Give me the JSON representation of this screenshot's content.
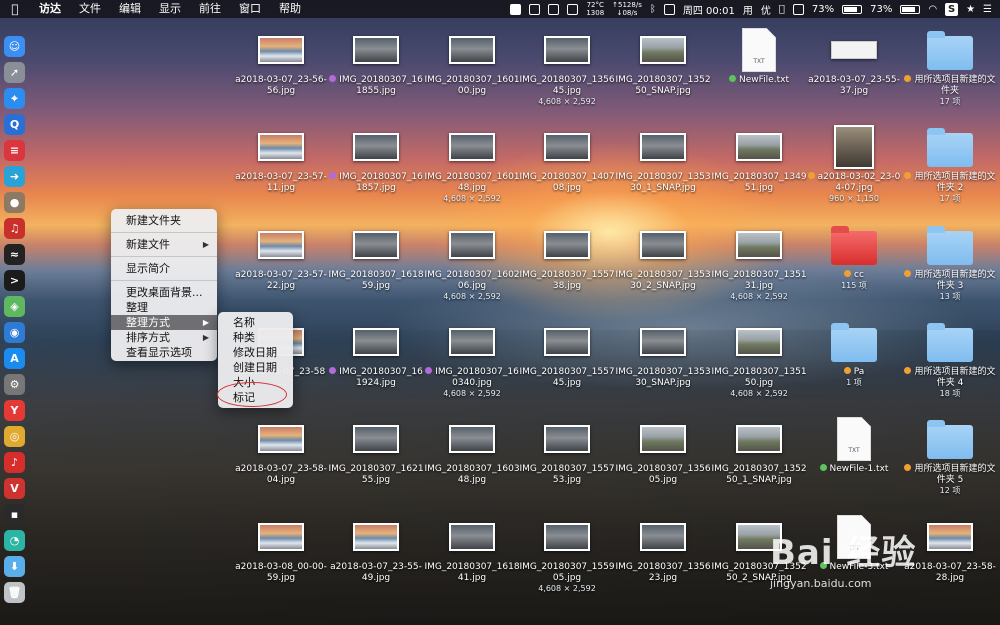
{
  "menubar": {
    "apple": "",
    "items": [
      "访达",
      "文件",
      "编辑",
      "显示",
      "前往",
      "窗口",
      "帮助"
    ],
    "status": {
      "temp": "72°C",
      "rpm": "1308",
      "net_up": "↑5128/s",
      "net_down": "↓08/s",
      "clock": "周四 00:01",
      "user_h": "用",
      "ime": "优",
      "battery1": "73%",
      "battery2": "73%"
    }
  },
  "dock": {
    "icons": [
      {
        "name": "finder-icon",
        "color": "#3b8ff2",
        "glyph": "☺"
      },
      {
        "name": "launchpad-icon",
        "color": "#8a8e96",
        "glyph": "➚"
      },
      {
        "name": "safari-icon",
        "color": "#2d8cf0",
        "glyph": "⌖"
      },
      {
        "name": "search-app-icon",
        "color": "#2a6fd6",
        "glyph": "Q"
      },
      {
        "name": "tool-app-icon",
        "color": "#d9363e",
        "glyph": "≡"
      },
      {
        "name": "migrate-icon",
        "color": "#2aa2d6",
        "glyph": "➜"
      },
      {
        "name": "rock-icon",
        "color": "#8c7a62",
        "glyph": "●"
      },
      {
        "name": "netease-icon",
        "color": "#c9302c",
        "glyph": "♫"
      },
      {
        "name": "activity-monitor-icon",
        "color": "#222",
        "glyph": "≈"
      },
      {
        "name": "terminal-icon",
        "color": "#1b1b1b",
        "glyph": ">"
      },
      {
        "name": "maps-icon",
        "color": "#5fb85f",
        "glyph": "◈"
      },
      {
        "name": "siri-icon",
        "color": "#2e7bd6",
        "glyph": "◉"
      },
      {
        "name": "app-store-icon",
        "color": "#1a8cf0",
        "glyph": "A"
      },
      {
        "name": "system-preferences-icon",
        "color": "#777",
        "glyph": "⚙"
      },
      {
        "name": "yandex-icon",
        "color": "#e53935",
        "glyph": "Y"
      },
      {
        "name": "chrome-icon",
        "color": "#e0a92f",
        "glyph": "◎"
      },
      {
        "name": "netease-music-icon",
        "color": "#d62d2d",
        "glyph": "♪"
      },
      {
        "name": "vivaldi-icon",
        "color": "#d0332f",
        "glyph": "V"
      },
      {
        "name": "terminal2-icon",
        "color": "#2a2a2a",
        "glyph": "▪"
      },
      {
        "name": "recorder-icon",
        "color": "#2bb5a5",
        "glyph": "◔"
      },
      {
        "name": "downloads-folder-icon",
        "color": "#5aaeea",
        "glyph": "⬇"
      },
      {
        "name": "trash-icon",
        "color": "#bfc3c8",
        "glyph": "🗑"
      }
    ]
  },
  "context_menu": {
    "items": [
      "新建文件夹",
      "新建文件",
      "显示简介",
      "更改桌面背景...",
      "整理",
      "整理方式",
      "排序方式",
      "查看显示选项"
    ],
    "submenu_arrow": "▶",
    "submenu": [
      "名称",
      "种类",
      "修改日期",
      "创建日期",
      "大小",
      "标记"
    ]
  },
  "desktop": {
    "rows": [
      [
        {
          "label": "a2018-03-07_23-56-56.jpg",
          "kind": "ocean",
          "dot": null,
          "meta": ""
        },
        {
          "label": "IMG_20180307_161855.jpg",
          "kind": "station",
          "dot": "#b46ad8",
          "meta": ""
        },
        {
          "label": "IMG_20180307_160100.jpg",
          "kind": "station",
          "dot": null,
          "meta": ""
        },
        {
          "label": "IMG_20180307_135645.jpg",
          "kind": "station",
          "dot": null,
          "meta": "4,608 × 2,592"
        },
        {
          "label": "IMG_20180307_135250_SNAP.jpg",
          "kind": "street",
          "dot": null,
          "meta": ""
        },
        {
          "label": "NewFile.txt",
          "kind": "doc",
          "dot": "#5ec35e",
          "meta": ""
        },
        {
          "label": "a2018-03-07_23-55-37.jpg",
          "kind": "keyboard",
          "dot": null,
          "meta": ""
        },
        {
          "label": "用所选项目新建的文件夹",
          "kind": "folder",
          "dot": "#f0a030",
          "meta": "17 项"
        }
      ],
      [
        {
          "label": "a2018-03-07_23-57-11.jpg",
          "kind": "ocean",
          "dot": null,
          "meta": ""
        },
        {
          "label": "IMG_20180307_161857.jpg",
          "kind": "station",
          "dot": "#b46ad8",
          "meta": ""
        },
        {
          "label": "IMG_20180307_160148.jpg",
          "kind": "station",
          "dot": null,
          "meta": "4,608 × 2,592"
        },
        {
          "label": "IMG_20180307_140708.jpg",
          "kind": "station",
          "dot": null,
          "meta": ""
        },
        {
          "label": "IMG_20180307_135330_1_SNAP.jpg",
          "kind": "station",
          "dot": null,
          "meta": ""
        },
        {
          "label": "IMG_20180307_134951.jpg",
          "kind": "street",
          "dot": null,
          "meta": ""
        },
        {
          "label": "a2018-03-02_23-04-07.jpg",
          "kind": "person",
          "dot": "#f0a030",
          "meta": "960 × 1,150"
        },
        {
          "label": "用所选项目新建的文件夹 2",
          "kind": "folder",
          "dot": "#f0a030",
          "meta": "17 项"
        }
      ],
      [
        {
          "label": "a2018-03-07_23-57-22.jpg",
          "kind": "ocean",
          "dot": null,
          "meta": ""
        },
        {
          "label": "IMG_20180307_161859.jpg",
          "kind": "station",
          "dot": null,
          "meta": ""
        },
        {
          "label": "IMG_20180307_160206.jpg",
          "kind": "station",
          "dot": null,
          "meta": "4,608 × 2,592"
        },
        {
          "label": "IMG_20180307_155738.jpg",
          "kind": "station",
          "dot": null,
          "meta": ""
        },
        {
          "label": "IMG_20180307_135330_2_SNAP.jpg",
          "kind": "station",
          "dot": null,
          "meta": ""
        },
        {
          "label": "IMG_20180307_135131.jpg",
          "kind": "street",
          "dot": null,
          "meta": "4,608 × 2,592"
        },
        {
          "label": "cc",
          "kind": "redbox",
          "dot": "#f0a030",
          "meta": "115 项"
        },
        {
          "label": "用所选项目新建的文件夹 3",
          "kind": "folder",
          "dot": "#f0a030",
          "meta": "13 项"
        }
      ],
      [
        {
          "label": "a2018-03-07_23-58-...",
          "kind": "ocean",
          "dot": null,
          "meta": ""
        },
        {
          "label": "IMG_20180307_161924.jpg",
          "kind": "station",
          "dot": "#b46ad8",
          "meta": ""
        },
        {
          "label": "IMG_20180307_160340.jpg",
          "kind": "station",
          "dot": "#b46ad8",
          "meta": "4,608 × 2,592"
        },
        {
          "label": "IMG_20180307_155745.jpg",
          "kind": "station",
          "dot": null,
          "meta": ""
        },
        {
          "label": "IMG_20180307_135330_SNAP.jpg",
          "kind": "station",
          "dot": null,
          "meta": ""
        },
        {
          "label": "IMG_20180307_135150.jpg",
          "kind": "street",
          "dot": null,
          "meta": "4,608 × 2,592"
        },
        {
          "label": "Pa",
          "kind": "folder",
          "dot": "#f0a030",
          "meta": "1 项"
        },
        {
          "label": "用所选项目新建的文件夹 4",
          "kind": "folder",
          "dot": "#f0a030",
          "meta": "18 项"
        }
      ],
      [
        {
          "label": "a2018-03-07_23-58-04.jpg",
          "kind": "ocean",
          "dot": null,
          "meta": ""
        },
        {
          "label": "IMG_20180307_162155.jpg",
          "kind": "station",
          "dot": null,
          "meta": ""
        },
        {
          "label": "IMG_20180307_160348.jpg",
          "kind": "station",
          "dot": null,
          "meta": ""
        },
        {
          "label": "IMG_20180307_155753.jpg",
          "kind": "station",
          "dot": null,
          "meta": ""
        },
        {
          "label": "IMG_20180307_135605.jpg",
          "kind": "street",
          "dot": null,
          "meta": ""
        },
        {
          "label": "IMG_20180307_135250_1_SNAP.jpg",
          "kind": "street",
          "dot": null,
          "meta": ""
        },
        {
          "label": "NewFile-1.txt",
          "kind": "doc",
          "dot": "#5ec35e",
          "meta": ""
        },
        {
          "label": "用所选项目新建的文件夹 5",
          "kind": "folder",
          "dot": "#f0a030",
          "meta": "12 项"
        }
      ],
      [
        {
          "label": "a2018-03-08_00-00-59.jpg",
          "kind": "ocean",
          "dot": null,
          "meta": ""
        },
        {
          "label": "a2018-03-07_23-55-49.jpg",
          "kind": "ocean",
          "dot": null,
          "meta": ""
        },
        {
          "label": "IMG_20180307_161841.jpg",
          "kind": "station",
          "dot": null,
          "meta": ""
        },
        {
          "label": "IMG_20180307_155905.jpg",
          "kind": "station",
          "dot": null,
          "meta": "4,608 × 2,592"
        },
        {
          "label": "IMG_20180307_135623.jpg",
          "kind": "station",
          "dot": null,
          "meta": ""
        },
        {
          "label": "IMG_20180307_135250_2_SNAP.jpg",
          "kind": "street",
          "dot": null,
          "meta": ""
        },
        {
          "label": "NewFile-3.txt",
          "kind": "doc",
          "dot": "#5ec35e",
          "meta": ""
        },
        {
          "label": "a2018-03-07_23-58-28.jpg",
          "kind": "ocean",
          "dot": null,
          "meta": ""
        }
      ]
    ],
    "doc_tag": "TXT"
  },
  "watermark": {
    "main": "Bai 经验",
    "sub": "jingyan.baidu.com"
  }
}
